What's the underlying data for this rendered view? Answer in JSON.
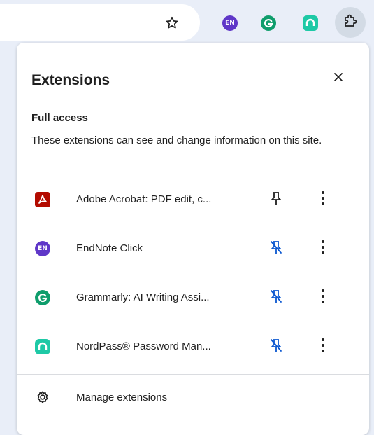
{
  "toolbar": {
    "bookmark_icon": "star-icon",
    "pinned_extensions": [
      {
        "icon": "endnote-icon",
        "badge_text": "EN",
        "color": "#5f37c8"
      },
      {
        "icon": "grammarly-icon",
        "color": "#0f9d6c"
      },
      {
        "icon": "nordpass-icon",
        "color": "#1ec9a6"
      }
    ],
    "extensions_button_icon": "puzzle-icon"
  },
  "panel": {
    "title": "Extensions",
    "close_icon": "close-icon",
    "section_heading": "Full access",
    "section_description": "These extensions can see and change information on this site.",
    "extensions": [
      {
        "name": "Adobe Acrobat: PDF edit, c...",
        "icon": "adobe-acrobat-icon",
        "pinned": false
      },
      {
        "name": "EndNote Click",
        "icon": "endnote-icon",
        "badge_text": "EN",
        "pinned": true
      },
      {
        "name": "Grammarly: AI Writing Assi...",
        "icon": "grammarly-icon",
        "pinned": true
      },
      {
        "name": "NordPass® Password Man...",
        "icon": "nordpass-icon",
        "pinned": true
      }
    ],
    "manage": {
      "label": "Manage extensions",
      "icon": "gear-icon"
    }
  },
  "colors": {
    "accent_blue": "#0b57d0",
    "adobe_red": "#b30b00",
    "toolbar_bg": "#e9eef8"
  }
}
